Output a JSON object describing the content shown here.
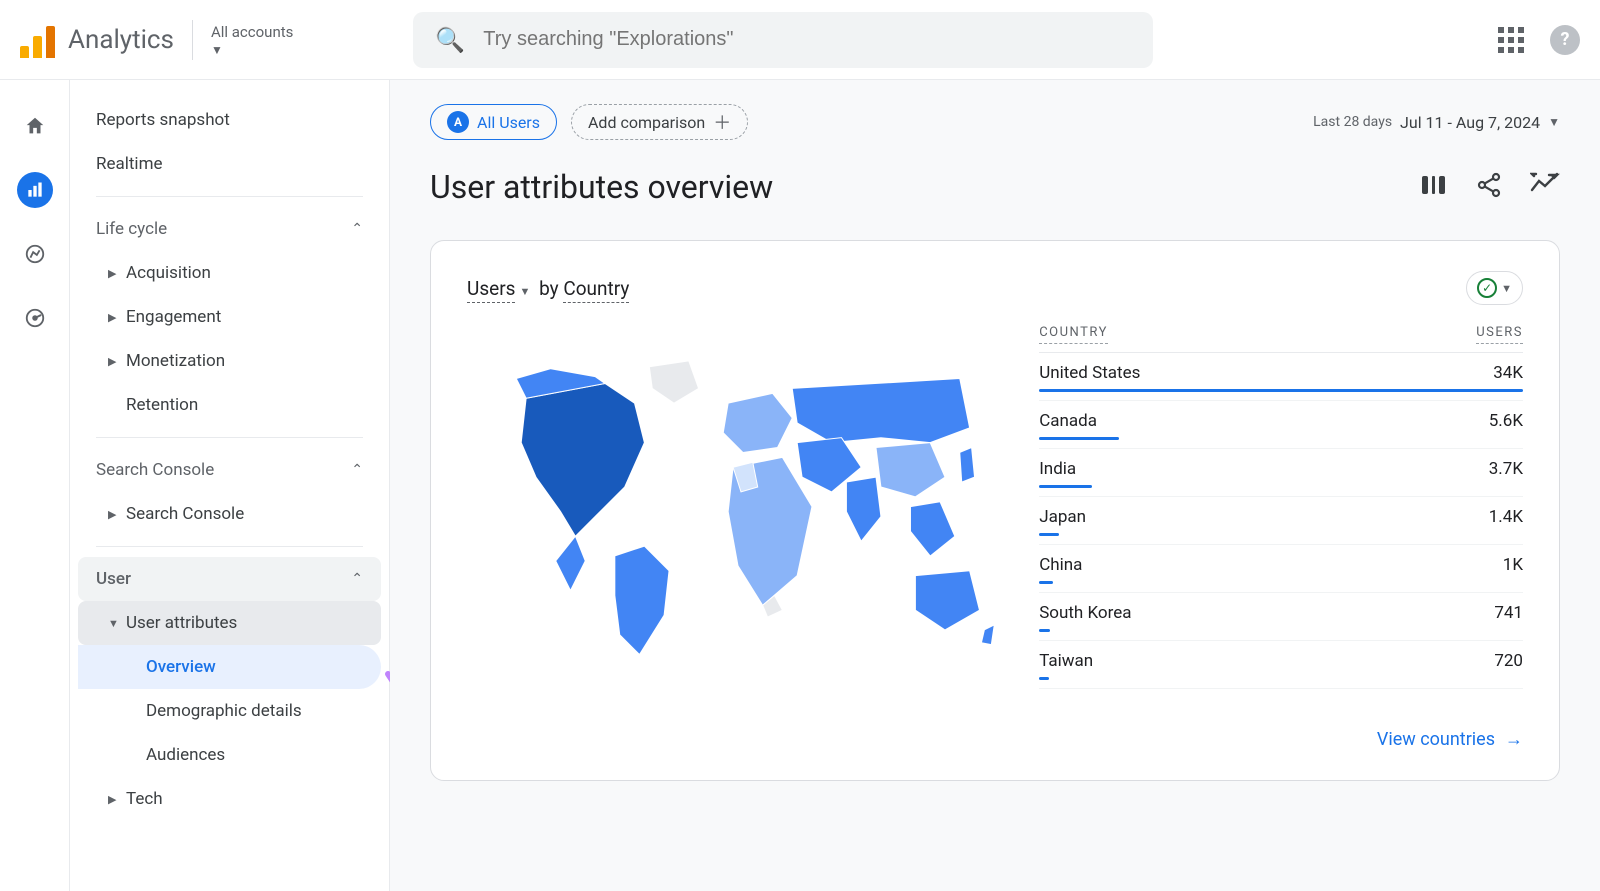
{
  "header": {
    "product": "Analytics",
    "account": "All accounts",
    "search_placeholder": "Try searching \"Explorations\""
  },
  "icon_rail": [
    {
      "name": "home-icon",
      "glyph": "⌂",
      "active": false
    },
    {
      "name": "reports-icon",
      "glyph": "▥",
      "active": true
    },
    {
      "name": "explore-icon",
      "glyph": "◉",
      "active": false
    },
    {
      "name": "advertising-icon",
      "glyph": "◎",
      "active": false
    }
  ],
  "sidebar": {
    "top": [
      {
        "label": "Reports snapshot"
      },
      {
        "label": "Realtime"
      }
    ],
    "lifecycle": {
      "header": "Life cycle",
      "items": [
        {
          "label": "Acquisition",
          "has_children": true
        },
        {
          "label": "Engagement",
          "has_children": true
        },
        {
          "label": "Monetization",
          "has_children": true
        },
        {
          "label": "Retention",
          "has_children": false
        }
      ]
    },
    "search_console": {
      "header": "Search Console",
      "items": [
        {
          "label": "Search Console",
          "has_children": true
        }
      ]
    },
    "user": {
      "header": "User",
      "user_attributes": {
        "label": "User attributes",
        "children": [
          {
            "label": "Overview",
            "active": true
          },
          {
            "label": "Demographic details",
            "active": false
          },
          {
            "label": "Audiences",
            "active": false
          }
        ]
      },
      "tech": {
        "label": "Tech"
      }
    }
  },
  "chips": {
    "all_users_badge": "A",
    "all_users": "All Users",
    "add_comparison": "Add comparison"
  },
  "date": {
    "label": "Last 28 days",
    "range": "Jul 11 - Aug 7, 2024"
  },
  "page_title": "User attributes overview",
  "card": {
    "metric_word": "Users",
    "dimension_word": "Country",
    "by": "by",
    "view_link": "View countries",
    "table_headers": {
      "country": "COUNTRY",
      "users": "USERS"
    }
  },
  "chart_data": {
    "type": "bar",
    "title": "Users by Country",
    "xlabel": "Country",
    "ylabel": "Users",
    "categories": [
      "United States",
      "Canada",
      "India",
      "Japan",
      "China",
      "South Korea",
      "Taiwan"
    ],
    "values": [
      34000,
      5600,
      3700,
      1400,
      1000,
      741,
      720
    ],
    "display_values": [
      "34K",
      "5.6K",
      "3.7K",
      "1.4K",
      "1K",
      "741",
      "720"
    ]
  },
  "colors": {
    "primary_blue": "#1a73e8",
    "map_dark": "#185abc",
    "map_mid": "#4285f4",
    "map_light": "#8ab4f8",
    "map_lighter": "#d2e3fc",
    "map_none": "#e8eaed"
  }
}
